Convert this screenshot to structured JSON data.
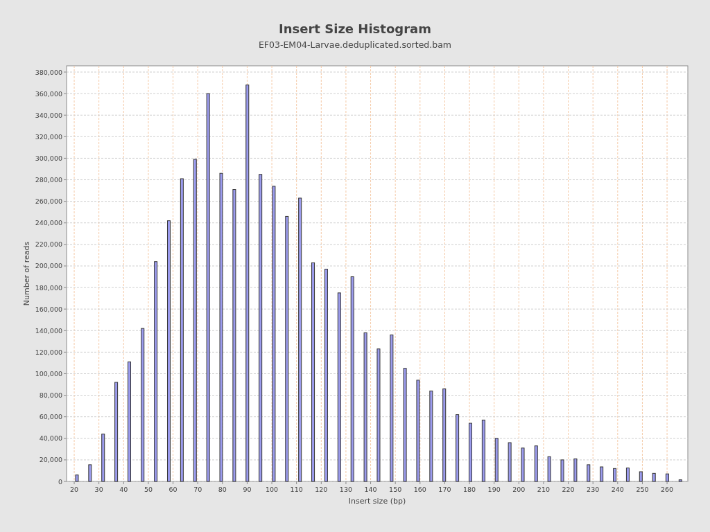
{
  "chart": {
    "title": "Insert Size Histogram",
    "subtitle": "EF03-EM04-Larvae.deduplicated.sorted.bam",
    "chart_data": {
      "type": "bar",
      "xlabel": "Insert size (bp)",
      "ylabel": "Number of reads",
      "x": [
        21.1,
        26.4,
        31.7,
        37.0,
        42.3,
        47.7,
        53.0,
        58.3,
        63.6,
        68.9,
        74.2,
        79.5,
        84.8,
        90.1,
        95.4,
        100.8,
        106.1,
        111.4,
        116.7,
        122.0,
        127.3,
        132.6,
        137.9,
        143.2,
        148.5,
        153.9,
        159.2,
        164.5,
        169.8,
        175.1,
        180.4,
        185.7,
        191.0,
        196.3,
        201.6,
        207.0,
        212.3,
        217.6,
        222.9,
        228.2,
        233.5,
        238.8,
        244.1,
        249.4,
        254.7,
        260.1,
        265.4
      ],
      "grid": true,
      "series": [
        {
          "color": "#9c9cee",
          "values": [
            6000,
            15500,
            44000,
            92000,
            111000,
            142000,
            204000,
            242000,
            281000,
            299000,
            360000,
            286000,
            271000,
            368000,
            285000,
            274000,
            246000,
            263000,
            203000,
            197000,
            175000,
            190000,
            138000,
            123000,
            136000,
            105000,
            94000,
            84000,
            86000,
            62000,
            54000,
            57000,
            40000,
            36000,
            31000,
            33000,
            23000,
            20000,
            21000,
            15500,
            13500,
            12000,
            12500,
            9000,
            7500,
            7000,
            1500
          ]
        }
      ],
      "xlim": [
        16.9,
        268.4
      ],
      "ylim": [
        0,
        385800
      ],
      "xticks": [
        20,
        30,
        40,
        50,
        60,
        70,
        80,
        90,
        100,
        110,
        120,
        130,
        140,
        150,
        160,
        170,
        180,
        190,
        200,
        210,
        220,
        230,
        240,
        250,
        260
      ],
      "yticks": [
        {
          "value": 0,
          "label": "0"
        },
        {
          "value": 20000,
          "label": "20,000"
        },
        {
          "value": 40000,
          "label": "40,000"
        },
        {
          "value": 60000,
          "label": "60,000"
        },
        {
          "value": 80000,
          "label": "80,000"
        },
        {
          "value": 100000,
          "label": "100,000"
        },
        {
          "value": 120000,
          "label": "120,000"
        },
        {
          "value": 140000,
          "label": "140,000"
        },
        {
          "value": 160000,
          "label": "160,000"
        },
        {
          "value": 180000,
          "label": "180,000"
        },
        {
          "value": 200000,
          "label": "200,000"
        },
        {
          "value": 220000,
          "label": "220,000"
        },
        {
          "value": 240000,
          "label": "240,000"
        },
        {
          "value": 260000,
          "label": "260,000"
        },
        {
          "value": 280000,
          "label": "280,000"
        },
        {
          "value": 300000,
          "label": "300,000"
        },
        {
          "value": 320000,
          "label": "320,000"
        },
        {
          "value": 340000,
          "label": "340,000"
        },
        {
          "value": 360000,
          "label": "360,000"
        },
        {
          "value": 380000,
          "label": "380,000"
        }
      ]
    }
  }
}
